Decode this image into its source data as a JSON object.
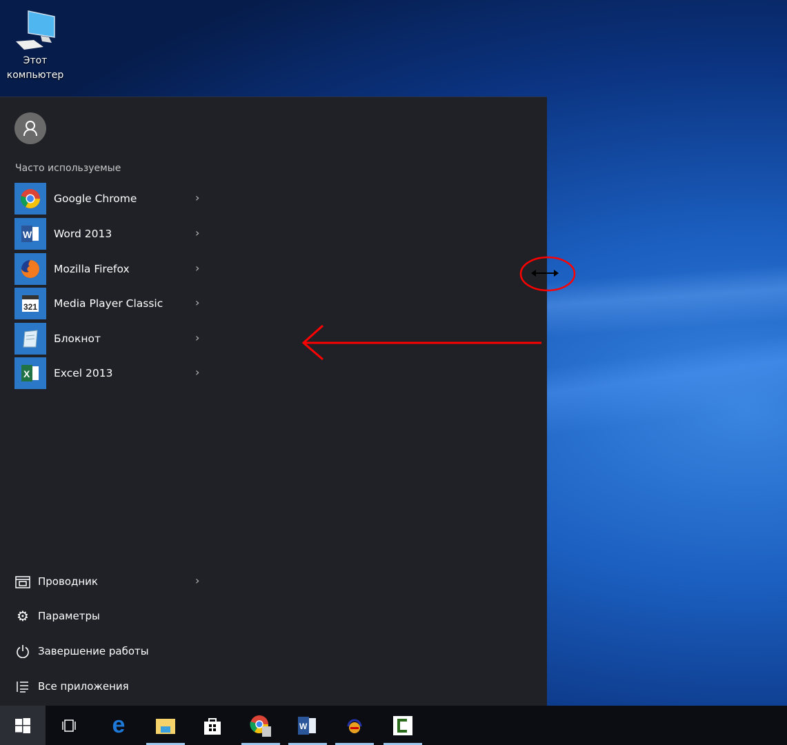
{
  "desktop": {
    "icon_label_line1": "Этот",
    "icon_label_line2": "компьютер"
  },
  "start_menu": {
    "section_title": "Часто используемые",
    "apps": [
      {
        "label": "Google Chrome",
        "icon": "chrome-icon"
      },
      {
        "label": "Word 2013",
        "icon": "word-icon"
      },
      {
        "label": "Mozilla Firefox",
        "icon": "firefox-icon"
      },
      {
        "label": "Media Player Classic",
        "icon": "media-player-icon"
      },
      {
        "label": "Блокнот",
        "icon": "notepad-icon"
      },
      {
        "label": "Excel 2013",
        "icon": "excel-icon"
      }
    ],
    "system": [
      {
        "label": "Проводник",
        "icon": "file-explorer-icon"
      },
      {
        "label": "Параметры",
        "icon": "gear-icon"
      },
      {
        "label": "Завершение работы",
        "icon": "power-icon"
      },
      {
        "label": "Все приложения",
        "icon": "list-icon"
      }
    ]
  },
  "taskbar": {
    "items": [
      "start",
      "task-view",
      "edge",
      "file-explorer",
      "store",
      "chrome",
      "word",
      "media",
      "camtasia"
    ]
  },
  "annotation_color": "#ff0000"
}
